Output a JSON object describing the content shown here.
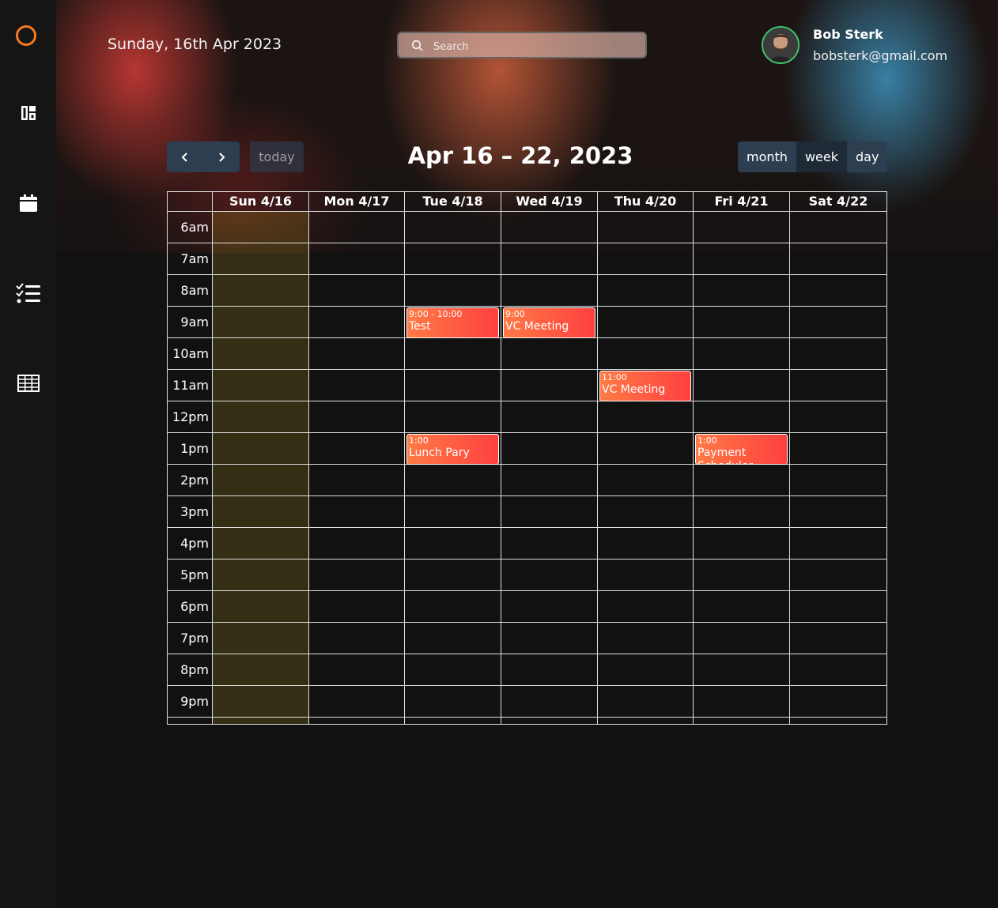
{
  "header": {
    "date": "Sunday, 16th Apr 2023",
    "search_placeholder": "Search",
    "user": {
      "name": "Bob Sterk",
      "email": "bobsterk@gmail.com"
    }
  },
  "sidebar": {
    "items": [
      {
        "icon": "logo-ring-icon"
      },
      {
        "icon": "dashboard-icon"
      },
      {
        "icon": "calendar-icon"
      },
      {
        "icon": "checklist-icon"
      },
      {
        "icon": "table-grid-icon"
      }
    ]
  },
  "toolbar": {
    "prev_icon": "chevron-left-icon",
    "next_icon": "chevron-right-icon",
    "today": "today",
    "title": "Apr 16 – 22, 2023",
    "views": [
      "month",
      "week",
      "day"
    ],
    "active_view": "week"
  },
  "calendar": {
    "days": [
      "Sun 4/16",
      "Mon 4/17",
      "Tue 4/18",
      "Wed 4/19",
      "Thu 4/20",
      "Fri 4/21",
      "Sat 4/22"
    ],
    "today_index": 0,
    "times": [
      "6am",
      "7am",
      "8am",
      "9am",
      "10am",
      "11am",
      "12pm",
      "1pm",
      "2pm",
      "3pm",
      "4pm",
      "5pm",
      "6pm",
      "7pm",
      "8pm",
      "9pm"
    ],
    "events": [
      {
        "day": 2,
        "start": "9:00",
        "time": "9:00 - 10:00",
        "title": "Test"
      },
      {
        "day": 3,
        "start": "9:00",
        "time": "9:00",
        "title": "VC Meeting"
      },
      {
        "day": 4,
        "start": "11:00",
        "time": "11:00",
        "title": "VC Meeting"
      },
      {
        "day": 2,
        "start": "13:00",
        "time": "1:00",
        "title": "Lunch Pary"
      },
      {
        "day": 5,
        "start": "13:00",
        "time": "1:00",
        "title": "Payment Scheduler"
      }
    ]
  },
  "colors": {
    "background": "#111111",
    "accent_orange": "#f47a1f",
    "button": "#2c3e50",
    "event_start": "#ff7a45",
    "event_end": "#ff4040",
    "today_highlight": "#3a3320"
  }
}
